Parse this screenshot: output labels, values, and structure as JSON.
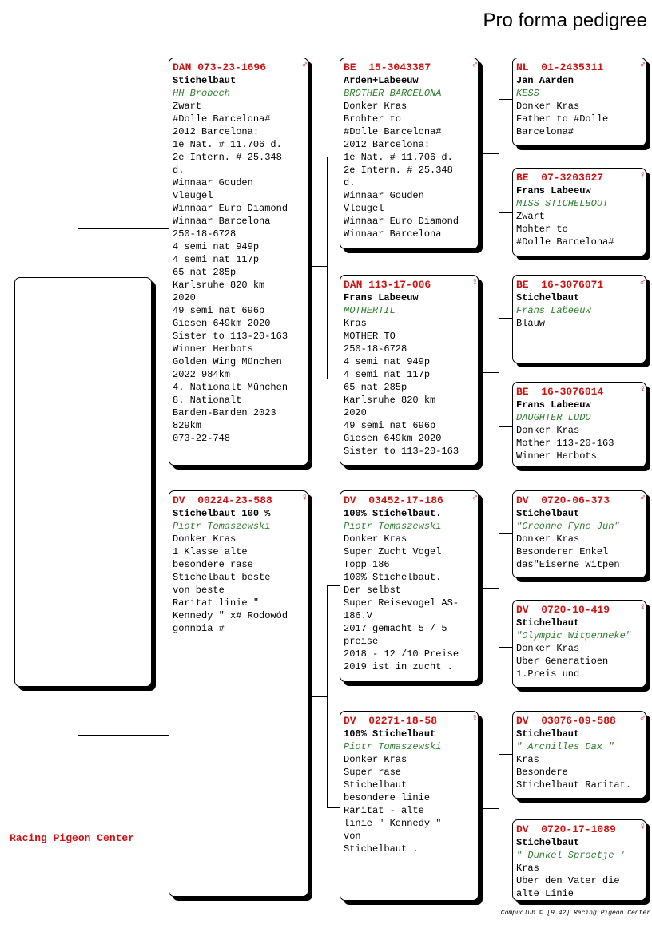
{
  "page_title": "Pro forma pedigree",
  "footer": {
    "left": "Racing Pigeon Center",
    "right": "Compuclub © [9.42]  Racing Pigeon Center"
  },
  "colors": {
    "ring": "#cc1111",
    "breeder": "#2e7d2e"
  },
  "cards": {
    "sire": {
      "ring": "DAN 073-23-1696",
      "sex": "♂",
      "name": "Stichelbaut",
      "breeder": "HH Brobech",
      "body": "Zwart\n#Dolle Barcelona#\n2012 Barcelona:\n1e Nat. # 11.706 d.\n2e Intern. # 25.348\nd.\nWinnaar Gouden\nVleugel\nWinnaar Euro Diamond\nWinnaar Barcelona\n250-18-6728\n4 semi nat 949p\n4 semi nat 117p\n65 nat 285p\nKarlsruhe 820 km\n2020\n49 semi nat 696p\nGiesen 649km 2020\nSister to 113-20-163\nWinner Herbots\nGolden Wing München\n2022 984km\n4. Nationalt München\n8. Nationalt\nBarden-Barden 2023\n829km\n073-22-748"
    },
    "dam": {
      "ring": "DV  00224-23-588",
      "sex": "♀",
      "name": "Stichelbaut 100 %",
      "breeder": "Piotr Tomaszewski",
      "body": "Donker Kras\n1 Klasse alte\nbesondere rase\nStichelbaut beste\nvon beste\nRaritat linie \"\nKennedy \" x# Rodowód\ngonnbia #"
    },
    "ss": {
      "ring": "BE  15-3043387",
      "sex": "♂",
      "name": "Arden+Labeeuw",
      "breeder": "BROTHER BARCELONA",
      "body": "Donker Kras\nBrohter to\n#Dolle Barcelona#\n2012 Barcelona:\n1e Nat. # 11.706 d.\n2e Intern. # 25.348\nd.\nWinnaar Gouden\nVleugel\nWinnaar Euro Diamond\nWinnaar Barcelona"
    },
    "sd": {
      "ring": "DAN 113-17-006",
      "sex": "♀",
      "name": "Frans Labeeuw",
      "breeder": "MOTHERTIL",
      "body": "Kras\nMOTHER TO\n250-18-6728\n4 semi nat 949p\n4 semi nat 117p\n65 nat 285p\nKarlsruhe 820 km\n2020\n49 semi nat 696p\nGiesen 649km 2020\nSister to 113-20-163"
    },
    "ds": {
      "ring": "DV  03452-17-186",
      "sex": "♂",
      "name": "100% Stichelbaut.",
      "breeder": "Piotr Tomaszewski",
      "body": "Donker Kras\nSuper Zucht Vogel\nTopp 186\n100% Stichelbaut.\nDer selbst\nSuper Reisevogel AS-\n186.V\n2017 gemacht 5 / 5\npreise\n2018 - 12 /10 Preise\n2019 ist in zucht ."
    },
    "dd": {
      "ring": "DV  02271-18-58",
      "sex": "♀",
      "name": "100% Stichelbaut",
      "breeder": "Piotr Tomaszewski",
      "body": "Donker Kras\nSuper rase\nStichelbaut\nbesondere linie\nRaritat - alte\nlinie \" Kennedy \"\nvon\nStichelbaut ."
    },
    "sss": {
      "ring": "NL  01-2435311",
      "sex": "♂",
      "name": "Jan Aarden",
      "breeder": "KESS",
      "body": "Donker Kras\nFather to #Dolle\nBarcelona#"
    },
    "ssd": {
      "ring": "BE  07-3203627",
      "sex": "♀",
      "name": "Frans Labeeuw",
      "breeder": "MISS STICHELBOUT",
      "body": "Zwart\nMohter to\n#Dolle Barcelona#"
    },
    "sds": {
      "ring": "BE  16-3076071",
      "sex": "♂",
      "name": "Stichelbaut",
      "breeder": "Frans Labeeuw",
      "body": "Blauw"
    },
    "sdd": {
      "ring": "BE  16-3076014",
      "sex": "♀",
      "name": "Frans Labeeuw",
      "breeder": "DAUGHTER LUDO",
      "body": "Donker Kras\nMother 113-20-163\nWinner Herbots"
    },
    "dss": {
      "ring": "DV  0720-06-373",
      "sex": "♂",
      "name": "Stichelbaut",
      "breeder": "\"Creonne Fyne Jun\"",
      "body": "Donker Kras\nBesonderer Enkel\ndas\"Eiserne Witpen"
    },
    "dsd": {
      "ring": "DV  0720-10-419",
      "sex": "♀",
      "name": "Stichelbaut",
      "breeder": "\"Olympic Witpenneke\"",
      "body": "Donker Kras\nUber Generatioen\n1.Preis und"
    },
    "dds": {
      "ring": "DV  03076-09-588",
      "sex": "♂",
      "name": "Stichelbaut",
      "breeder": "\" Archilles Dax \"",
      "body": "Kras\nBesondere\nStichelbaut Raritat."
    },
    "ddd": {
      "ring": "DV  0720-17-1089",
      "sex": "♀",
      "name": "Stichelbaut",
      "breeder": "\" Dunkel Sproetje '",
      "body": "Kras\nUber den Vater die\nalte Linie"
    }
  }
}
